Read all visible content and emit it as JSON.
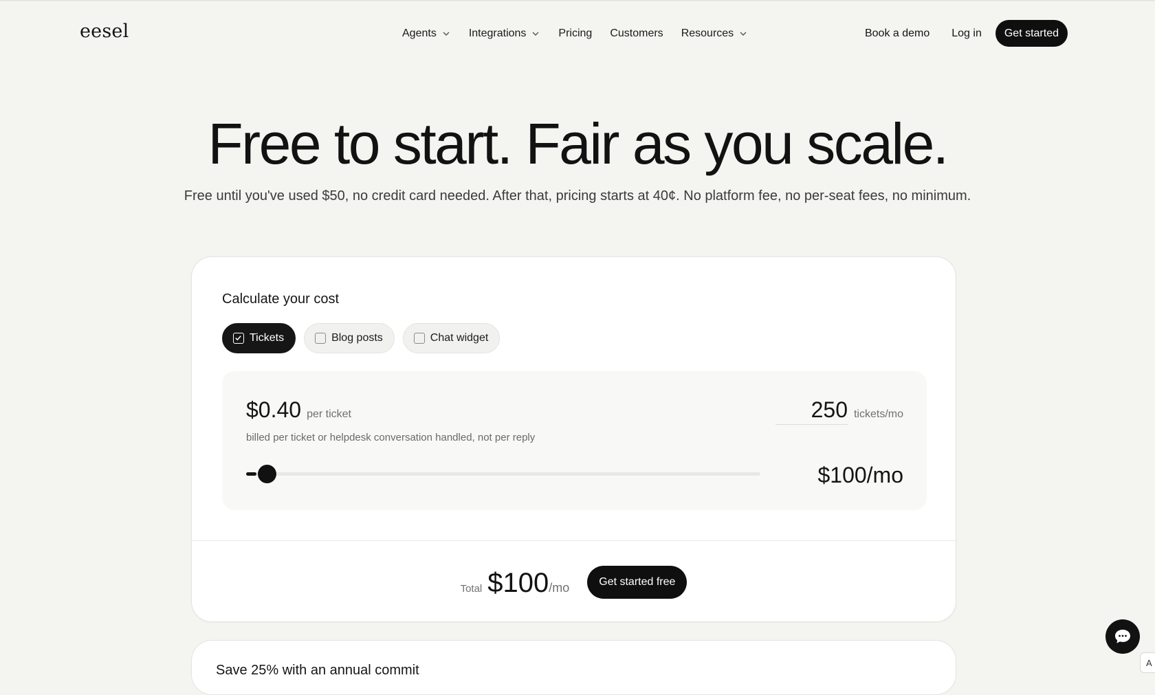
{
  "header": {
    "logo": "eesel",
    "nav": [
      {
        "label": "Agents",
        "has_dropdown": true
      },
      {
        "label": "Integrations",
        "has_dropdown": true
      },
      {
        "label": "Pricing",
        "has_dropdown": false
      },
      {
        "label": "Customers",
        "has_dropdown": false
      },
      {
        "label": "Resources",
        "has_dropdown": true
      }
    ],
    "book_demo": "Book a demo",
    "log_in": "Log in",
    "get_started": "Get started"
  },
  "hero": {
    "title": "Free to start. Fair as you scale.",
    "subtitle": "Free until you've used $50, no credit card needed. After that, pricing starts at 40¢. No platform fee, no per-seat fees, no minimum."
  },
  "calculator": {
    "title": "Calculate your cost",
    "options": [
      {
        "label": "Tickets",
        "checked": true
      },
      {
        "label": "Blog posts",
        "checked": false
      },
      {
        "label": "Chat widget",
        "checked": false
      }
    ],
    "tickets": {
      "price": "$0.40",
      "price_unit": "per ticket",
      "billing_note": "billed per ticket or helpdesk conversation handled, not per reply",
      "quantity": "250",
      "quantity_unit": "tickets/mo",
      "slider_fraction": 0.02,
      "monthly_cost": "$100/mo"
    },
    "total": {
      "label": "Total",
      "amount": "$100",
      "unit": "/mo",
      "cta": "Get started free"
    }
  },
  "next_card": {
    "title": "Save 25% with an annual commit"
  },
  "chat_widget": {
    "icon": "chat-bubble-icon"
  },
  "edge_tab": {
    "label": "A"
  },
  "colors": {
    "background": "#f4f4f0",
    "primary": "#0f0f0f",
    "card": "#ffffff"
  }
}
